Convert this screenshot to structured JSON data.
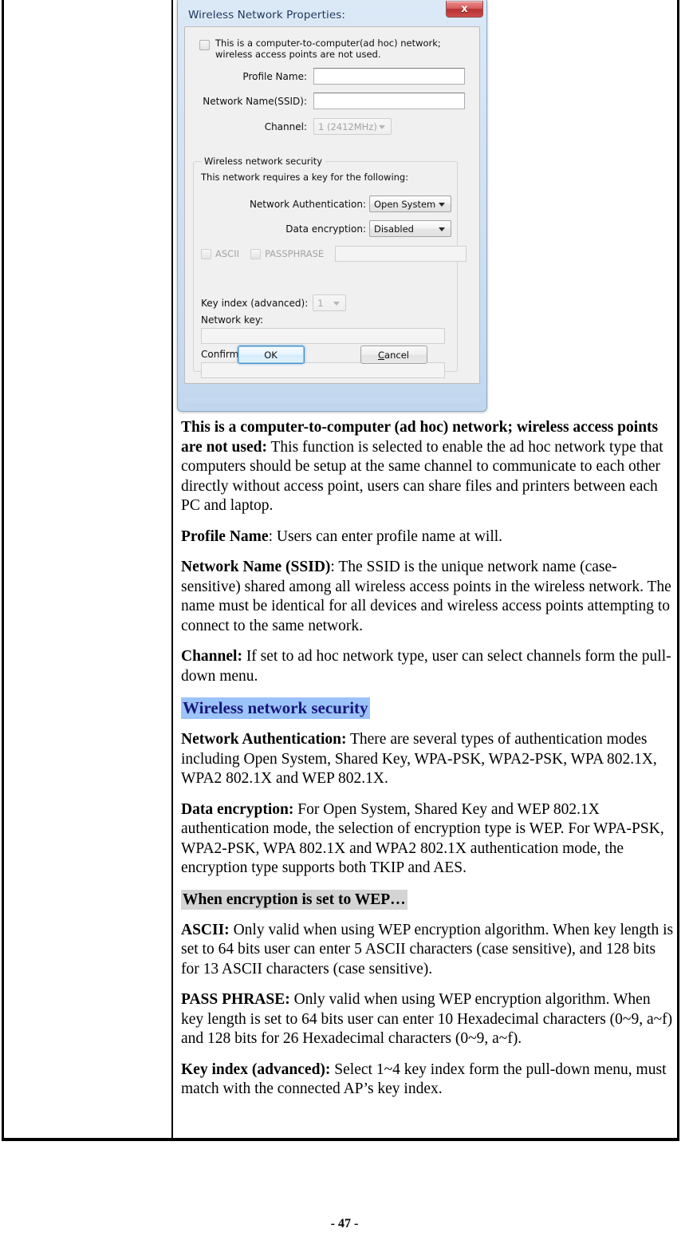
{
  "page": {
    "footer_label": "- 47 -"
  },
  "dialog": {
    "title": "Wireless Network Properties:",
    "close_icon_label": "x",
    "adhoc_checkbox_label": "This is a computer-to-computer(ad hoc) network; wireless access points are not used.",
    "profile_name_label": "Profile Name:",
    "profile_name_value": "",
    "ssid_label": "Network Name(SSID):",
    "ssid_value": "",
    "channel_label": "Channel:",
    "channel_value": "1 (2412MHz)",
    "security": {
      "group_title": "Wireless network security",
      "note": "This network requires a key for the following:",
      "auth_label": "Network Authentication:",
      "auth_value": "Open System",
      "encryption_label": "Data encryption:",
      "encryption_value": "Disabled",
      "ascii_label": "ASCII",
      "passphrase_label": "PASSPHRASE",
      "passphrase_value": "",
      "key_index_label": "Key index (advanced):",
      "key_index_value": "1",
      "network_key_label": "Network key:",
      "network_key_value": "",
      "confirm_key_label": "Confirm network key:",
      "confirm_key_value": ""
    },
    "ok_label": "OK",
    "cancel_label_first": "C",
    "cancel_label_rest": "ancel"
  },
  "body": {
    "p_adhoc": {
      "lead": "This is a computer-to-computer (ad hoc) network; wireless access points are not used:",
      "text": " This function is selected to enable the ad hoc network type that computers should be setup at the same channel to communicate to each other directly without access point, users can share files and printers between each PC and laptop."
    },
    "p_profile": {
      "lead": "Profile Name",
      "text": ": Users can enter profile name at will."
    },
    "p_ssid": {
      "lead": "Network Name (SSID)",
      "text": ": The SSID is the unique network name (case-sensitive) shared among all wireless access points in the wireless network. The name must be identical for all devices and wireless access points attempting to connect to the same network."
    },
    "p_channel": {
      "lead": "Channel:",
      "text": " If set to ad hoc network type, user can select channels form the pull-down menu."
    },
    "heading_security": "Wireless network security",
    "p_auth": {
      "lead": "Network Authentication:",
      "text": " There are several types of authentication modes including Open System, Shared Key, WPA-PSK, WPA2-PSK, WPA 802.1X, WPA2 802.1X and WEP 802.1X."
    },
    "p_encryption": {
      "lead": "Data encryption:",
      "text": " For Open System, Shared Key and WEP 802.1X authentication mode, the selection of encryption type is WEP. For WPA-PSK, WPA2-PSK, WPA 802.1X and WPA2 802.1X authentication mode, the encryption type supports both TKIP and AES."
    },
    "heading_wep": "When encryption is set to WEP…",
    "p_ascii": {
      "lead": "ASCII:",
      "text": " Only valid when using WEP encryption algorithm. When key length is set to 64 bits user can enter 5 ASCII characters (case sensitive), and 128 bits for 13 ASCII characters (case sensitive)."
    },
    "p_passphrase": {
      "lead": "PASS PHRASE:",
      "text": " Only valid when using WEP encryption algorithm. When key length is set to 64 bits user can enter 10 Hexadecimal characters (0~9, a~f) and 128 bits for 26 Hexadecimal characters (0~9, a~f)."
    },
    "p_keyindex": {
      "lead": "Key index (advanced):",
      "text": " Select 1~4 key index form the pull-down menu, must match with the connected AP’s key index."
    }
  }
}
